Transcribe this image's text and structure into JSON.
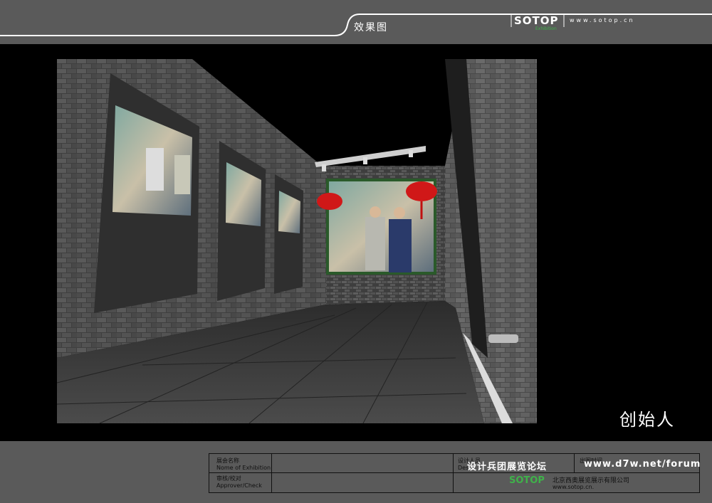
{
  "header": {
    "title": "效果图",
    "logo": "SOTOP",
    "logo_sub": "Exhibition",
    "url": "www.sotop.cn"
  },
  "caption": "创始人",
  "title_block": {
    "exhibition_label_cn": "展会名称",
    "exhibition_label_en": "Nome of Exhibition",
    "approver_label_cn": "审核/校对",
    "approver_label_en": "Approver/Check",
    "designer_label_cn": "设计人员",
    "designer_label_en": "Des",
    "date_label_cn": "出图时间",
    "watermark_left": "设计兵团展览论坛",
    "watermark_right": "www.d7w.net/forum",
    "company_logo": "SOTOP",
    "company_name": "北京西奥展览展示有限公司",
    "company_url": "www.sotop.cn."
  },
  "colors": {
    "panel_gray": "#5a5a5a",
    "accent_green": "#3fb24a",
    "lantern_red": "#d01818"
  }
}
